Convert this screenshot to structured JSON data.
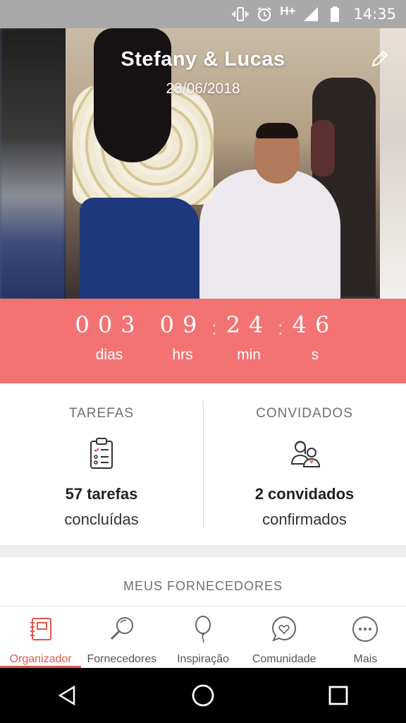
{
  "status_bar": {
    "network": "H+",
    "time": "14:35",
    "icons": [
      "vibrate-icon",
      "alarm-icon",
      "signal-icon",
      "battery-icon"
    ]
  },
  "hero": {
    "couple_names": "Stefany & Lucas",
    "wedding_date": "23/06/2018",
    "edit_icon": "pencil-icon"
  },
  "countdown": {
    "days": "003",
    "days_label": "dias",
    "hours": "09",
    "hours_label": "hrs",
    "minutes": "24",
    "minutes_label": "min",
    "seconds": "46",
    "seconds_label": "s",
    "background_color": "#f37373"
  },
  "summary": {
    "tasks": {
      "heading": "TAREFAS",
      "icon": "checklist-clipboard-icon",
      "value": "57 tarefas",
      "caption": "concluídas"
    },
    "guests": {
      "heading": "CONVIDADOS",
      "icon": "couple-guests-icon",
      "value": "2 convidados",
      "caption": "confirmados"
    }
  },
  "suppliers": {
    "heading": "MEUS FORNECEDORES"
  },
  "bottom_nav": {
    "accent_color": "#e2574f",
    "items": [
      {
        "label": "Organizador",
        "icon": "planner-book-icon",
        "active": true
      },
      {
        "label": "Fornecedores",
        "icon": "magnifier-icon",
        "active": false
      },
      {
        "label": "Inspiração",
        "icon": "balloon-icon",
        "active": false
      },
      {
        "label": "Comunidade",
        "icon": "heart-chat-bubble-icon",
        "active": false
      },
      {
        "label": "Mais",
        "icon": "more-dots-icon",
        "active": false
      }
    ]
  },
  "system_nav": {
    "buttons": [
      "back-triangle-icon",
      "home-circle-icon",
      "recents-square-icon"
    ]
  }
}
